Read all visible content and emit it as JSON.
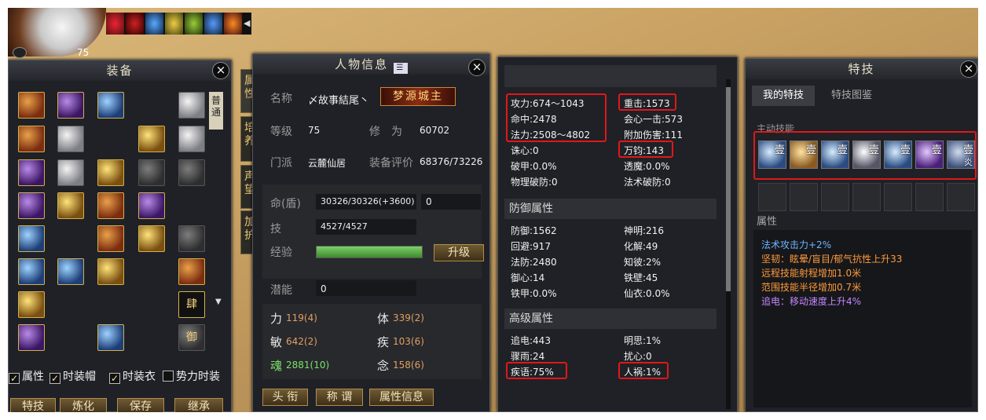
{
  "hud": {
    "level": "75"
  },
  "equipment": {
    "title": "装备",
    "normal_tab": "普通",
    "rune_si": "肆",
    "rune_yu": "御",
    "checks": [
      "属性",
      "时装帽",
      "时装衣",
      "势力时装"
    ],
    "buttons": [
      "特技",
      "炼化",
      "保存",
      "继承"
    ]
  },
  "tabs": [
    "属性",
    "培养",
    "声望",
    "加护"
  ],
  "info": {
    "title": "人物信息",
    "name_label": "名称",
    "name": "〆故事結尾丶",
    "title_badge": "梦源城主",
    "level_label": "等级",
    "level": "75",
    "cultivation_label": "修　为",
    "cultivation": "60702",
    "sect_label": "门派",
    "sect": "云麓仙居",
    "equip_score_label": "装备评价",
    "equip_score": "68376/73226",
    "hp_label": "命(盾)",
    "hp": "30326/30326(+3600)",
    "hp_extra": "0",
    "skill_label": "技",
    "skill": "4527/4527",
    "exp_label": "经验",
    "upgrade": "升级",
    "potential_label": "潜能",
    "potential": "0",
    "attrs": [
      {
        "label": "力",
        "value": "119(4)"
      },
      {
        "label": "体",
        "value": "339(2)"
      },
      {
        "label": "敏",
        "value": "642(2)"
      },
      {
        "label": "疾",
        "value": "103(6)"
      },
      {
        "label": "魂",
        "value": "2881(10)"
      },
      {
        "label": "念",
        "value": "158(6)"
      }
    ],
    "buttons": [
      "头 衔",
      "称 谓",
      "属性信息"
    ]
  },
  "stats": {
    "basic": [
      "攻力:674～1043",
      "重击:1573",
      "命中:2478",
      "会心一击:573",
      "法力:2508～4802",
      "附加伤害:111",
      "诛心:0",
      "万钧:143",
      "破甲:0.0%",
      "透魔:0.0%",
      "物理破防:0",
      "法术破防:0"
    ],
    "defense_title": "防御属性",
    "defense": [
      "防御:1562",
      "神明:216",
      "回避:917",
      "化解:49",
      "法防:2480",
      "知彼:2%",
      "御心:14",
      "铁壁:45",
      "铁甲:0.0%",
      "仙衣:0.0%"
    ],
    "advanced_title": "高级属性",
    "advanced": [
      "追电:443",
      "明思:1%",
      "骤雨:24",
      "扰心:0",
      "疾语:75%",
      "人祸:1%"
    ]
  },
  "skills": {
    "title": "特技",
    "tabs": [
      "我的特技",
      "特技图鉴"
    ],
    "active_label": "主动技能",
    "slot_marks": [
      "壹",
      "壹",
      "壹",
      "壹",
      "壹",
      "壹",
      "壹"
    ],
    "slot_subscript": "炎",
    "attr_label": "属性",
    "attrs": [
      "法术攻击力+2%",
      "坚韧：眩晕/盲目/郁气抗性上升33",
      "远程技能射程增加1.0米",
      "范围技能半径增加0.7米",
      "追电：移动速度上升4%"
    ]
  }
}
